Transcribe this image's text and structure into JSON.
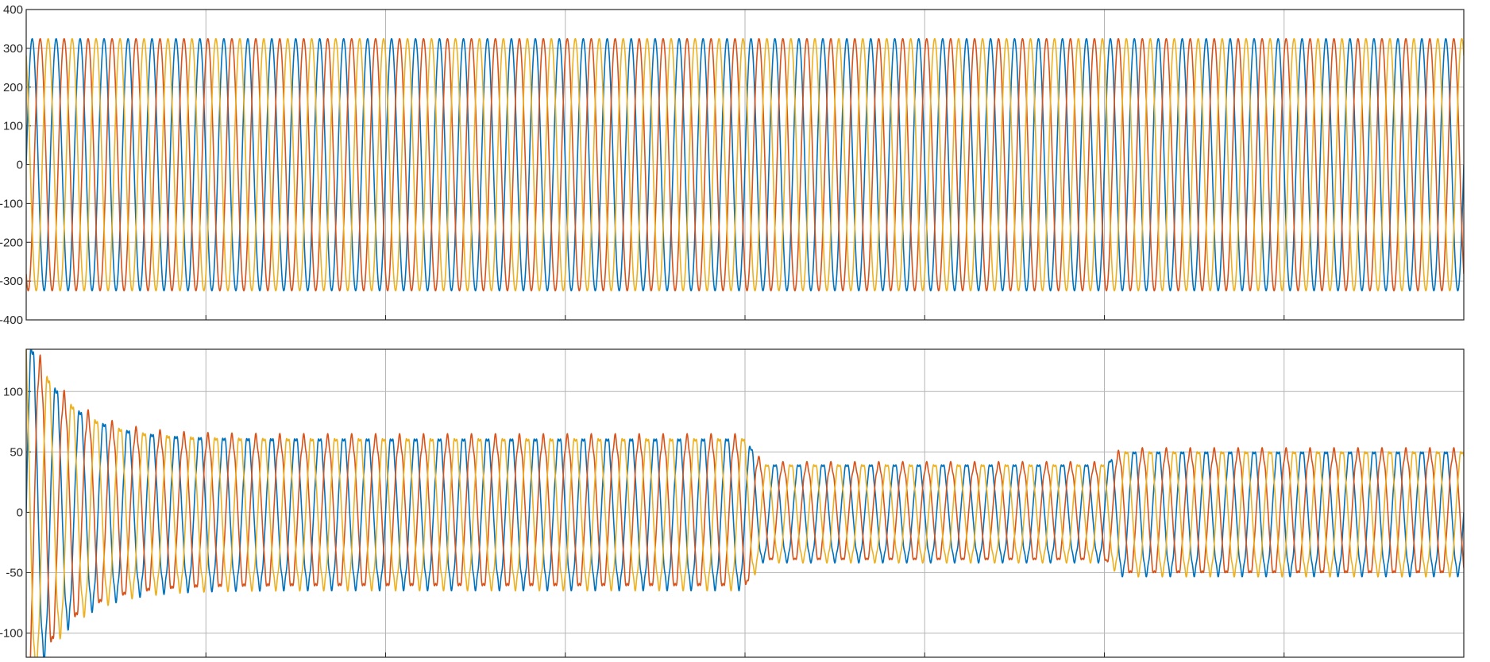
{
  "chart_data": [
    {
      "type": "line",
      "title": "",
      "xlabel": "",
      "ylabel": "",
      "ylim": [
        -400,
        400
      ],
      "yticks": [
        400,
        300,
        200,
        100,
        0,
        -100,
        -200,
        -300,
        -400
      ],
      "ytick_labels": [
        "400",
        "300",
        "200",
        "100",
        "0",
        "-100",
        "-200",
        "-300",
        "-400"
      ],
      "grid": true,
      "legend": "none",
      "cycles_shown": 60,
      "series": [
        {
          "color": "#0072BD",
          "amplitude": 325,
          "phase_deg": 0
        },
        {
          "color": "#D95319",
          "amplitude": 325,
          "phase_deg": -120
        },
        {
          "color": "#EDB120",
          "amplitude": 325,
          "phase_deg": 120
        }
      ]
    },
    {
      "type": "line",
      "title": "",
      "xlabel": "",
      "ylabel": "",
      "ylim": [
        -120,
        135
      ],
      "yticks": [
        100,
        50,
        0,
        -50,
        -100
      ],
      "ytick_labels": [
        "100",
        "50",
        "0",
        "-50",
        "-100"
      ],
      "grid": true,
      "legend": "none",
      "cycles_shown": 60,
      "amplitude_segments": [
        {
          "x_start": 0.0,
          "x_end": 0.5,
          "amplitude": 62
        },
        {
          "x_start": 0.5,
          "x_end": 0.75,
          "amplitude": 40
        },
        {
          "x_start": 0.75,
          "x_end": 1.0,
          "amplitude": 51
        }
      ],
      "transient_peak": 150,
      "series": [
        {
          "color": "#0072BD",
          "phase_deg": 0
        },
        {
          "color": "#D95319",
          "phase_deg": -120
        },
        {
          "color": "#EDB120",
          "phase_deg": 120
        }
      ]
    }
  ]
}
